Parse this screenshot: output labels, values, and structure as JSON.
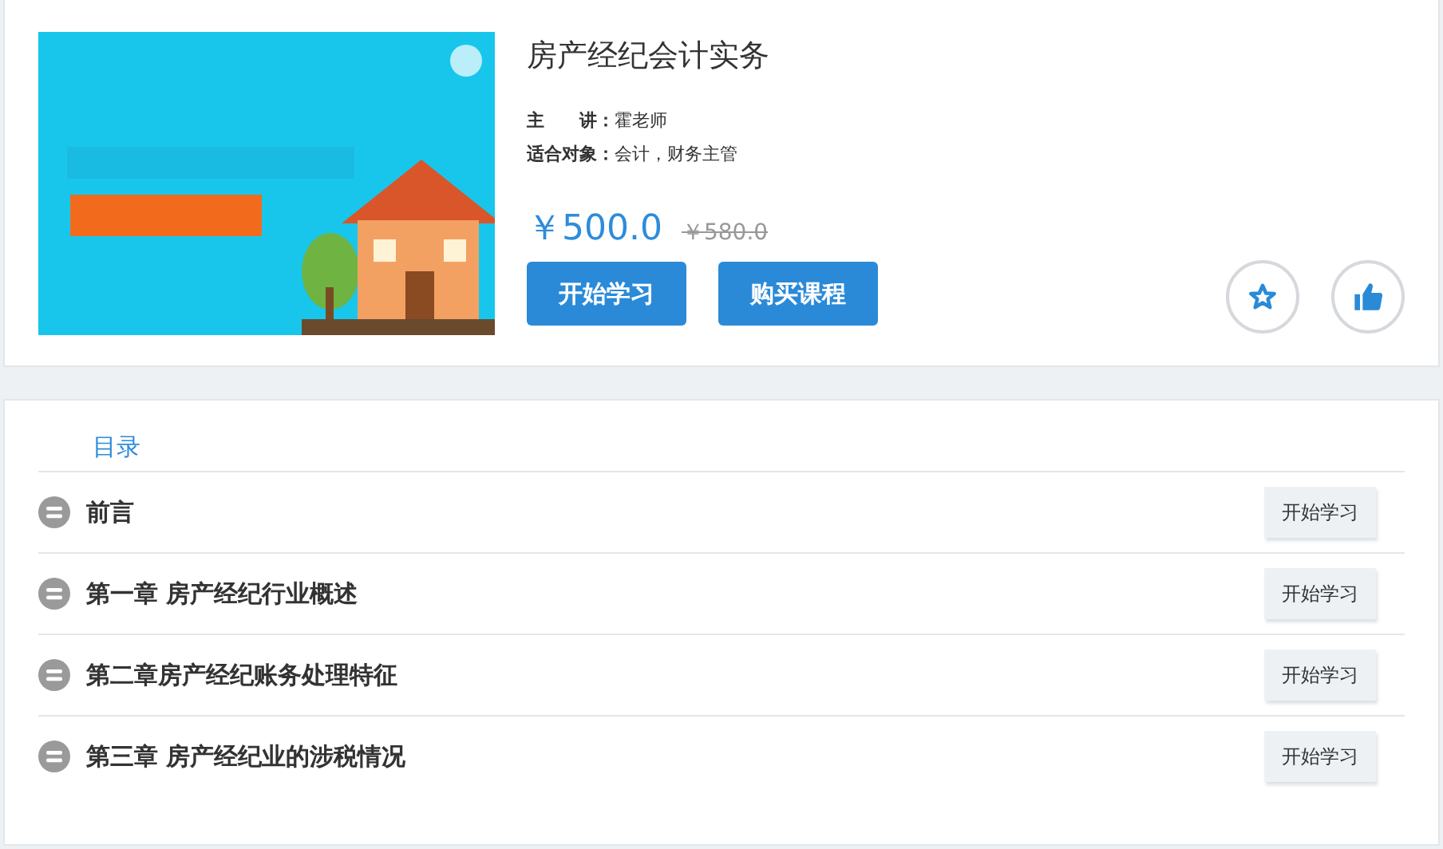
{
  "course": {
    "title": "房产经纪会计实务",
    "meta": [
      {
        "label": "主　　讲：",
        "value": "霍老师"
      },
      {
        "label": "适合对象：",
        "value": "会计，财务主管"
      }
    ],
    "price": "￥500.0",
    "original_price": "￥580.0",
    "buttons": [
      "开始学习",
      "购买课程"
    ]
  },
  "catalog": {
    "tab": "目录",
    "chapters": [
      {
        "title": "前言",
        "action": "开始学习"
      },
      {
        "title": "第一章 房产经纪行业概述",
        "action": "开始学习"
      },
      {
        "title": "第二章房产经纪账务处理特征",
        "action": "开始学习"
      },
      {
        "title": "第三章 房产经纪业的涉税情况",
        "action": "开始学习"
      }
    ]
  }
}
